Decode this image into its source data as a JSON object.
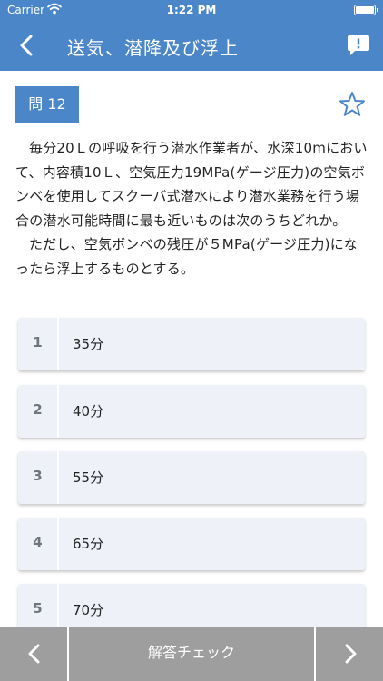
{
  "status_bar": {
    "carrier": "Carrier",
    "time": "1:22 PM",
    "icons": [
      "wifi-icon",
      "battery-icon"
    ]
  },
  "navbar": {
    "title": "送気、潜降及び浮上",
    "back_icon": "chevron-left-icon",
    "report_icon": "report-bubble-icon"
  },
  "question": {
    "badge": "問 12",
    "bookmark_icon": "star-outline-icon",
    "paragraphs": [
      "毎分20Ｌの呼吸を行う潜水作業者が、水深10mにおいて、内容積10Ｌ、空気圧力19MPa(ゲージ圧力)の空気ボンベを使用してスクーバ式潜水により潜水業務を行う場合の潜水可能時間に最も近いものは次のうちどれか。",
      "ただし、空気ボンベの残圧が５MPa(ゲージ圧力)になったら浮上するものとする。"
    ]
  },
  "options": [
    {
      "number": "1",
      "text": "35分"
    },
    {
      "number": "2",
      "text": "40分"
    },
    {
      "number": "3",
      "text": "55分"
    },
    {
      "number": "4",
      "text": "65分"
    },
    {
      "number": "5",
      "text": "70分"
    }
  ],
  "toolbar": {
    "prev_icon": "chevron-left-icon",
    "check_label": "解答チェック",
    "next_icon": "chevron-right-icon"
  },
  "colors": {
    "accent": "#4a86c8",
    "option_background": "#eef2f8",
    "toolbar_background": "#9e9e9e"
  }
}
